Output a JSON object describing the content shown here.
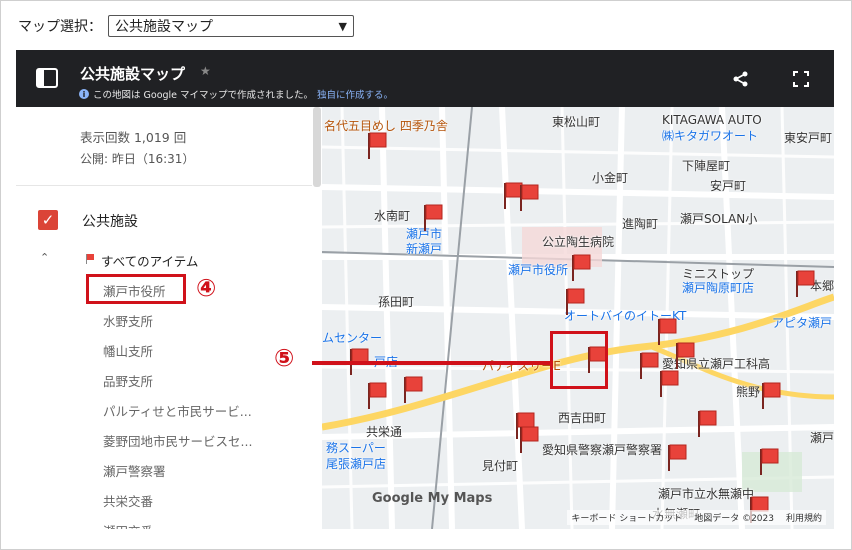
{
  "selector": {
    "label": "マップ選択：",
    "value": "公共施設マップ"
  },
  "mymaps": {
    "title": "公共施設マップ",
    "subtitle_prefix": "この地図は Google マイマップで作成されました。",
    "subtitle_link": "独自に作成する。",
    "info_icon": "info-icon",
    "share_icon": "share-icon",
    "fullscreen_icon": "fullscreen-icon"
  },
  "panel": {
    "views": "表示回数 1,019 回",
    "published": "公開: 昨日（16:31）",
    "layer_name": "公共施設",
    "all_items": "すべてのアイテム",
    "items": [
      "瀬戸市役所",
      "水野支所",
      "幡山支所",
      "品野支所",
      "パルティせと市民サービ...",
      "菱野団地市民サービスセ...",
      "瀬戸警察署",
      "共栄交番",
      "瀬田交番"
    ]
  },
  "callouts": {
    "four": "④",
    "five": "⑤"
  },
  "map": {
    "labels": [
      {
        "text": "名代五目めし 四季乃舎",
        "cls": "o"
      },
      {
        "text": "東松山町",
        "cls": ""
      },
      {
        "text": "KITAGAWA AUTO",
        "cls": ""
      },
      {
        "text": "㈱キタガワオート",
        "cls": "b"
      },
      {
        "text": "東安戸町",
        "cls": ""
      },
      {
        "text": "下陣屋町",
        "cls": ""
      },
      {
        "text": "小金町",
        "cls": ""
      },
      {
        "text": "安戸町",
        "cls": ""
      },
      {
        "text": "水南町",
        "cls": ""
      },
      {
        "text": "進陶町",
        "cls": ""
      },
      {
        "text": "瀬戸SOLAN小",
        "cls": ""
      },
      {
        "text": "瀬戸市",
        "cls": "b"
      },
      {
        "text": "新瀬戸",
        "cls": "b"
      },
      {
        "text": "公立陶生病院",
        "cls": ""
      },
      {
        "text": "瀬戸市役所",
        "cls": "b"
      },
      {
        "text": "ミニストップ",
        "cls": ""
      },
      {
        "text": "瀬戸陶原町店",
        "cls": "b"
      },
      {
        "text": "孫田町",
        "cls": ""
      },
      {
        "text": "オートバイのイトーKT",
        "cls": "b"
      },
      {
        "text": "アピタ瀬戸",
        "cls": "b"
      },
      {
        "text": "ムセンター",
        "cls": "b"
      },
      {
        "text": "戸店",
        "cls": "b"
      },
      {
        "text": "愛知県立瀬戸工科高",
        "cls": ""
      },
      {
        "text": "パティスリーE",
        "cls": "o"
      },
      {
        "text": "熊野",
        "cls": ""
      },
      {
        "text": "西吉田町",
        "cls": ""
      },
      {
        "text": "共栄通",
        "cls": ""
      },
      {
        "text": "務スーパー",
        "cls": "b"
      },
      {
        "text": "尾張瀬戸店",
        "cls": "b"
      },
      {
        "text": "愛知県警察瀬戸警察署",
        "cls": ""
      },
      {
        "text": "見付町",
        "cls": ""
      },
      {
        "text": "瀬戸市立水無瀬中",
        "cls": ""
      },
      {
        "text": "瀬戸",
        "cls": ""
      },
      {
        "text": "本郷",
        "cls": ""
      },
      {
        "text": "水無瀬町",
        "cls": ""
      }
    ],
    "google_maps": "Google My Maps",
    "footer": [
      "キーボード ショートカット",
      "地図データ ©2023",
      "利用規約"
    ]
  },
  "colors": {
    "flag": "#e8423a",
    "highlight": "#d0111a",
    "header": "#202124"
  }
}
